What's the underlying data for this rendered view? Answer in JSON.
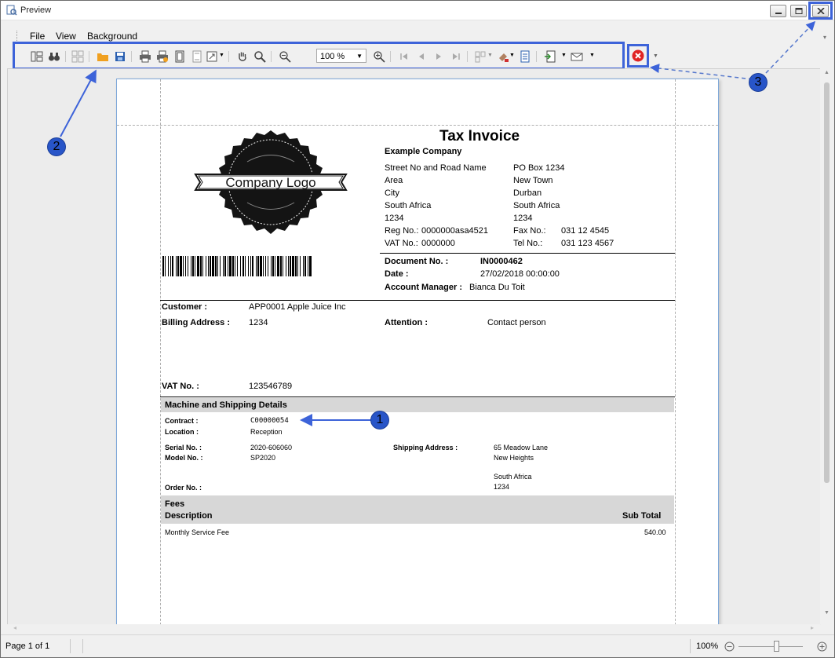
{
  "window": {
    "title": "Preview"
  },
  "menu": {
    "items": [
      "File",
      "View",
      "Background"
    ]
  },
  "toolbar": {
    "zoom_value": "100 %",
    "buttons": [
      "panels-icon",
      "find-icon",
      "thumbnails-icon",
      "open-icon",
      "save-icon",
      "print-icon",
      "quick-print-icon",
      "page-setup-icon",
      "header-footer-icon",
      "scale-icon",
      "hand-tool-icon",
      "magnifier-icon",
      "zoom-out-icon",
      "zoom-in-icon",
      "first-page-icon",
      "previous-page-icon",
      "next-page-icon",
      "last-page-icon",
      "multipage-icon",
      "color-icon",
      "watermark-icon",
      "export-icon",
      "send-email-icon",
      "close-preview-icon"
    ]
  },
  "callouts": [
    "1",
    "2",
    "3"
  ],
  "invoice": {
    "title": "Tax Invoice",
    "company": "Example Company",
    "logo_text": "Company Logo",
    "address_left": [
      "Street No and Road Name",
      "Area",
      "City",
      "South Africa",
      "1234"
    ],
    "address_right": [
      "PO Box 1234",
      "New Town",
      "Durban",
      "South Africa",
      "1234"
    ],
    "reg_label": "Reg No.:",
    "reg_value": "0000000asa4521",
    "fax_label": "Fax No.:",
    "fax_value": "031 12 4545",
    "vat_label": "VAT No.:",
    "vat_value": "0000000",
    "tel_label": "Tel No.:",
    "tel_value": "031 123 4567",
    "doc_no_label": "Document No. :",
    "doc_no_value": "IN0000462",
    "date_label": "Date :",
    "date_value": "27/02/2018 00:00:00",
    "account_manager_label": "Account Manager :",
    "account_manager_value": "Bianca Du Toit",
    "customer_label": "Customer :",
    "customer_value": "APP0001 Apple Juice Inc",
    "billing_label": "Billing Address :",
    "billing_value": "1234",
    "attention_label": "Attention :",
    "attention_value": "Contact person",
    "cust_vat_label": "VAT No. :",
    "cust_vat_value": "123546789",
    "machine_header": "Machine and Shipping Details",
    "contract_label": "Contract :",
    "contract_value": "C00000054",
    "location_label": "Location :",
    "location_value": "Reception",
    "serial_label": "Serial No. :",
    "serial_value": "2020-606060",
    "model_label": "Model No. :",
    "model_value": "SP2020",
    "shipping_label": "Shipping Address :",
    "shipping_lines": [
      "65 Meadow Lane",
      "New Heights",
      "",
      "South Africa",
      "1234"
    ],
    "order_label": "Order No. :",
    "fees_header": "Fees",
    "desc_header": "Description",
    "subtotal_header": "Sub Total",
    "fee_description": "Monthly Service Fee",
    "fee_amount": "540.00"
  },
  "status": {
    "page_info": "Page 1 of 1",
    "zoom": "100%"
  },
  "colors": {
    "highlight": "#3d63d9",
    "callout": "#2855c8",
    "page_border": "#7fa8d9"
  }
}
